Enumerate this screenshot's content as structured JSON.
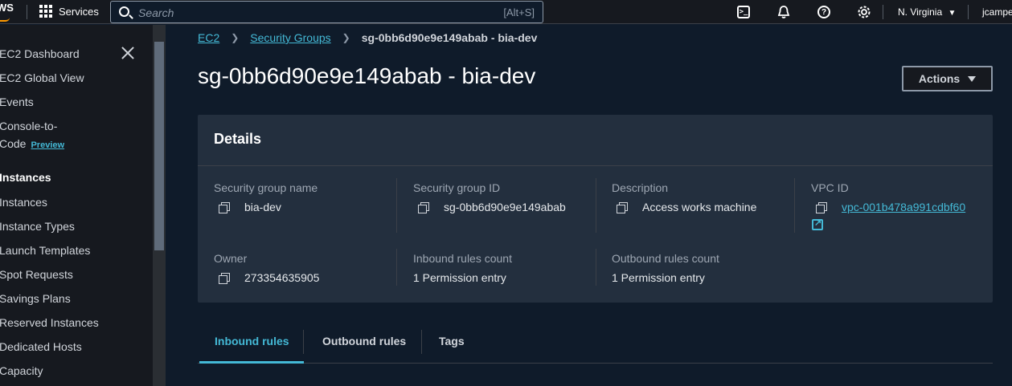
{
  "topnav": {
    "logo_text": "WS",
    "services_label": "Services",
    "search_placeholder": "Search",
    "search_shortcut": "[Alt+S]",
    "region": "N. Virginia",
    "user": "jcampe"
  },
  "sidebar": {
    "items": [
      {
        "label": "EC2 Dashboard"
      },
      {
        "label": "EC2 Global View"
      },
      {
        "label": "Events"
      },
      {
        "label": "Console-to-"
      },
      {
        "label": "Code",
        "badge": "Preview"
      },
      {
        "label": "Instances",
        "heading": true
      },
      {
        "label": "Instances"
      },
      {
        "label": "Instance Types"
      },
      {
        "label": "Launch Templates"
      },
      {
        "label": "Spot Requests"
      },
      {
        "label": "Savings Plans"
      },
      {
        "label": "Reserved Instances"
      },
      {
        "label": "Dedicated Hosts"
      },
      {
        "label": "Capacity"
      }
    ]
  },
  "breadcrumb": {
    "items": [
      "EC2",
      "Security Groups"
    ],
    "current": "sg-0bb6d90e9e149abab - bia-dev"
  },
  "page": {
    "title": "sg-0bb6d90e9e149abab - bia-dev",
    "actions_label": "Actions"
  },
  "details": {
    "heading": "Details",
    "fields": [
      {
        "label": "Security group name",
        "value": "bia-dev"
      },
      {
        "label": "Security group ID",
        "value": "sg-0bb6d90e9e149abab"
      },
      {
        "label": "Description",
        "value": "Access works machine"
      },
      {
        "label": "VPC ID",
        "value": "vpc-001b478a991cdbf60"
      },
      {
        "label": "Owner",
        "value": "273354635905"
      },
      {
        "label": "Inbound rules count",
        "value": "1 Permission entry"
      },
      {
        "label": "Outbound rules count",
        "value": "1 Permission entry"
      }
    ]
  },
  "tabs": [
    {
      "label": "Inbound rules",
      "active": true
    },
    {
      "label": "Outbound rules"
    },
    {
      "label": "Tags"
    }
  ]
}
